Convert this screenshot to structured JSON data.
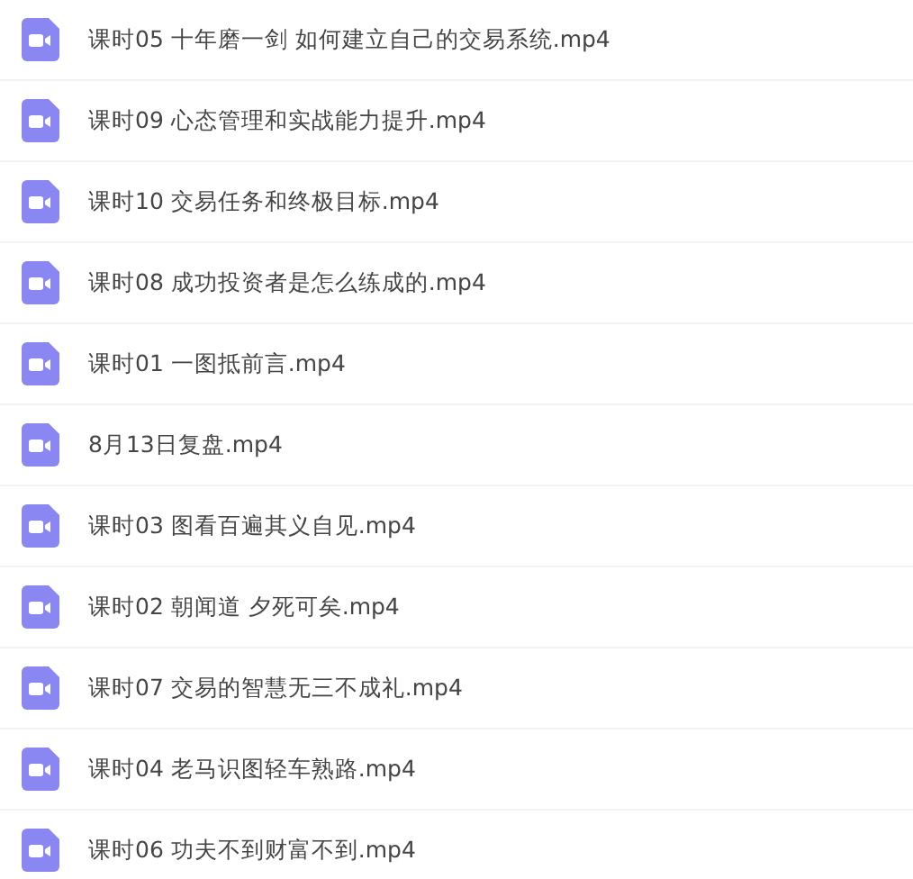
{
  "files": [
    {
      "name": "课时05 十年磨一剑 如何建立自己的交易系统.mp4"
    },
    {
      "name": "课时09 心态管理和实战能力提升.mp4"
    },
    {
      "name": "课时10 交易任务和终极目标.mp4"
    },
    {
      "name": "课时08 成功投资者是怎么练成的.mp4"
    },
    {
      "name": "课时01 一图抵前言.mp4"
    },
    {
      "name": "8月13日复盘.mp4"
    },
    {
      "name": "课时03 图看百遍其义自见.mp4"
    },
    {
      "name": "课时02 朝闻道 夕死可矣.mp4"
    },
    {
      "name": "课时07 交易的智慧无三不成礼.mp4"
    },
    {
      "name": "课时04 老马识图轻车熟路.mp4"
    },
    {
      "name": "课时06 功夫不到财富不到.mp4"
    }
  ]
}
